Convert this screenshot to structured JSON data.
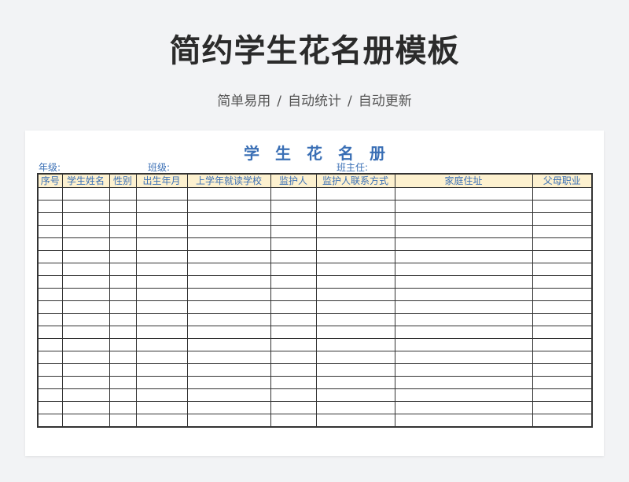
{
  "header": {
    "title": "简约学生花名册模板",
    "subtitle_parts": [
      "简单易用",
      "自动统计",
      "自动更新"
    ],
    "separator": "/"
  },
  "sheet": {
    "title": "学生花名册",
    "meta": {
      "grade_label": "年级:",
      "class_label": "班级:",
      "teacher_label": "班主任:"
    },
    "columns": [
      "序号",
      "学生姓名",
      "性别",
      "出生年月",
      "上学年就读学校",
      "监护人",
      "监护人联系方式",
      "家庭住址",
      "父母职业"
    ],
    "empty_row_count": 19
  },
  "colors": {
    "accent": "#3a6fb5",
    "header_fill": "#fdf1cf",
    "background": "#f2f3f5"
  }
}
